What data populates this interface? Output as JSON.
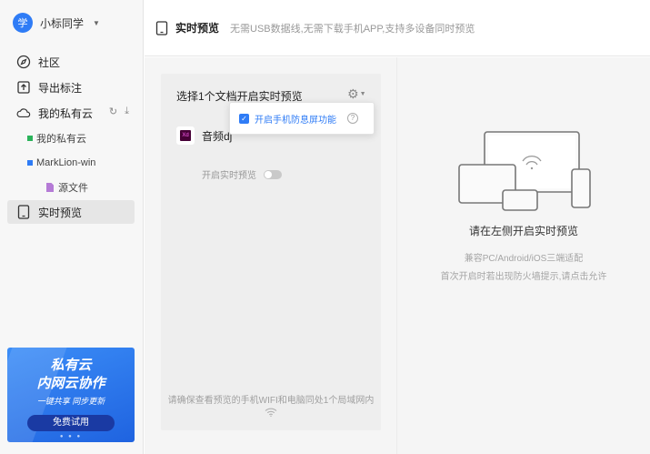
{
  "user": {
    "avatar_text": "学",
    "name": "小标同学"
  },
  "nav": {
    "community": "社区",
    "export": "导出标注",
    "cloud": "我的私有云",
    "cloud_sub": [
      {
        "label": "我的私有云",
        "color": "#2bb35a"
      },
      {
        "label": "MarkLion-win",
        "color": "#2f7cf6"
      }
    ],
    "source_files": "源文件",
    "live_preview": "实时预览"
  },
  "banner": {
    "line1": "私有云",
    "line2": "内网云协作",
    "line3": "一键共享  同步更新",
    "button": "免费试用",
    "dots": "● ● ●"
  },
  "header": {
    "title": "实时预览",
    "subtitle": "无需USB数据线,无需下载手机APP,支持多设备同时预览"
  },
  "panel": {
    "title": "选择1个文档开启实时预览",
    "file_badge": "Xd",
    "file_name": "音频dj",
    "toggle_label": "开启实时预览",
    "note": "请确保查看预览的手机WIFI和电脑同处1个局域网内"
  },
  "popup": {
    "label": "开启手机防息屏功能",
    "help": "?"
  },
  "right": {
    "title": "请在左侧开启实时预览",
    "line1": "兼容PC/Android/iOS三端适配",
    "line2": "首次开启时若出现防火墙提示,请点击允许"
  },
  "colors": {
    "accent": "#2f7cf6",
    "banner": "#1f63e0"
  }
}
